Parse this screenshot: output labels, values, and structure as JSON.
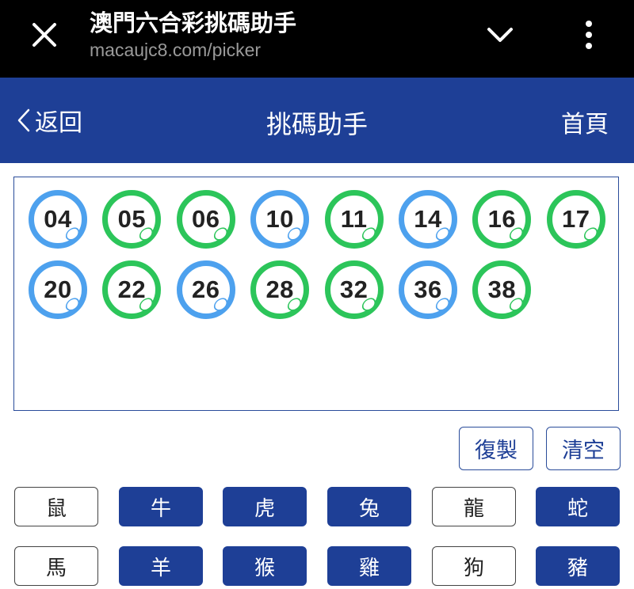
{
  "browser": {
    "title": "澳門六合彩挑碼助手",
    "url": "macaujc8.com/picker"
  },
  "header": {
    "back_label": "返回",
    "title": "挑碼助手",
    "home_label": "首頁"
  },
  "picked_balls": [
    {
      "number": "04",
      "color": "blue"
    },
    {
      "number": "05",
      "color": "green"
    },
    {
      "number": "06",
      "color": "green"
    },
    {
      "number": "10",
      "color": "blue"
    },
    {
      "number": "11",
      "color": "green"
    },
    {
      "number": "14",
      "color": "blue"
    },
    {
      "number": "16",
      "color": "green"
    },
    {
      "number": "17",
      "color": "green"
    },
    {
      "number": "20",
      "color": "blue"
    },
    {
      "number": "22",
      "color": "green"
    },
    {
      "number": "26",
      "color": "blue"
    },
    {
      "number": "28",
      "color": "green"
    },
    {
      "number": "32",
      "color": "green"
    },
    {
      "number": "36",
      "color": "blue"
    },
    {
      "number": "38",
      "color": "green"
    }
  ],
  "actions": {
    "copy_label": "復製",
    "clear_label": "清空"
  },
  "zodiacs": [
    {
      "label": "鼠",
      "selected": false
    },
    {
      "label": "牛",
      "selected": true
    },
    {
      "label": "虎",
      "selected": true
    },
    {
      "label": "兔",
      "selected": true
    },
    {
      "label": "龍",
      "selected": false
    },
    {
      "label": "蛇",
      "selected": true
    },
    {
      "label": "馬",
      "selected": false
    },
    {
      "label": "羊",
      "selected": true
    },
    {
      "label": "猴",
      "selected": true
    },
    {
      "label": "雞",
      "selected": true
    },
    {
      "label": "狗",
      "selected": false
    },
    {
      "label": "豬",
      "selected": true
    }
  ],
  "colors": {
    "brand_blue": "#1e3f96",
    "ball_blue": "#4da1ee",
    "ball_green": "#2cc55a"
  }
}
